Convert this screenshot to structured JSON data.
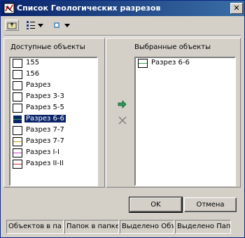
{
  "window": {
    "title": "Список Геологических разрезов",
    "close_glyph": "✕",
    "app_icon": "map-app-icon"
  },
  "toolbar": {
    "up_icon": "folder-up-icon",
    "view_icon": "list-view-icon",
    "filter_icon": "square-filter-icon"
  },
  "available": {
    "label": "Доступные объекты",
    "items": [
      {
        "label": "155",
        "color": "#000000",
        "line": false
      },
      {
        "label": "156",
        "color": "#000000",
        "line": false
      },
      {
        "label": "Разрез",
        "color": "#000000",
        "line": false
      },
      {
        "label": "Разрез 3-3",
        "color": "#000000",
        "line": false
      },
      {
        "label": "Разрез 5-5",
        "color": "#000000",
        "line": false
      },
      {
        "label": "Разрез 6-6",
        "color": "#3a9a55",
        "line": true,
        "selected": true
      },
      {
        "label": "Разрез 7-7",
        "color": "#000000",
        "line": false
      },
      {
        "label": "Разрез 7-7",
        "color": "#c8a000",
        "line": true
      },
      {
        "label": "Разрез I-I",
        "color": "#c040c0",
        "line": true
      },
      {
        "label": "Разрез II-II",
        "color": "#cc3030",
        "line": true
      }
    ]
  },
  "selected": {
    "label": "Выбранные объекты",
    "items": [
      {
        "label": "Разрез 6-6",
        "color": "#3a9a55",
        "line": true
      }
    ]
  },
  "actions": {
    "add_icon": "arrow-right-icon",
    "remove_icon": "x-remove-icon"
  },
  "buttons": {
    "ok": "OK",
    "cancel": "Отмена"
  },
  "status": {
    "objects_in_folder": "Объектов в па",
    "folders_in_folder": "Папок в папке",
    "selected_objects": "Выделено Объ",
    "selected_folders": "Выделено Папо"
  }
}
